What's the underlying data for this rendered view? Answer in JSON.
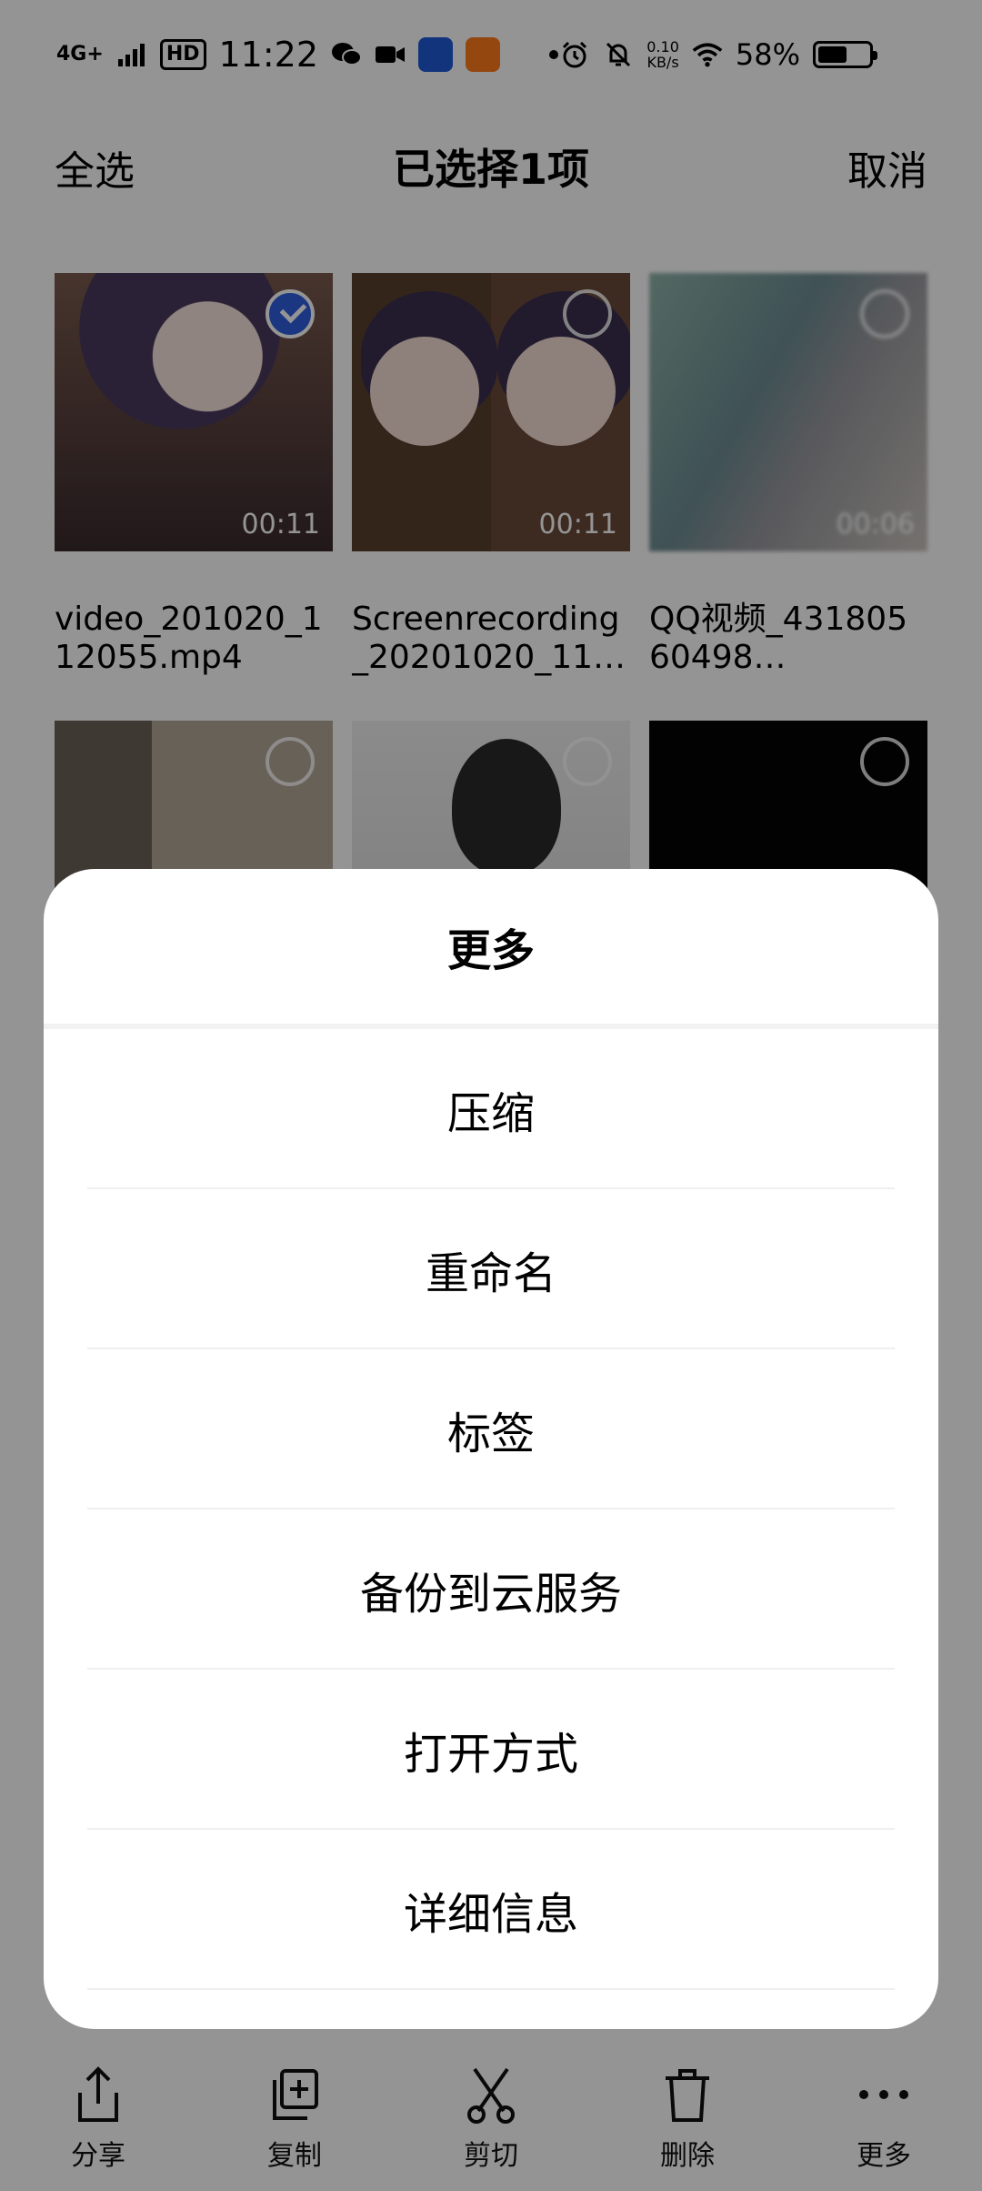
{
  "status_bar": {
    "network": "4G+",
    "hd": "HD",
    "time": "11:22",
    "speed": "0.10\nKB/s",
    "battery": "58%",
    "battery_level": 0.58
  },
  "header": {
    "select_all": "全选",
    "title": "已选择1项",
    "cancel": "取消"
  },
  "files": [
    {
      "name": "video_201020_112055.mp4",
      "duration": "00:11",
      "selected": true
    },
    {
      "name": "Screenrecording_20201020_1111…",
      "duration": "00:11",
      "selected": false
    },
    {
      "name": "QQ视频_43180560498…",
      "duration": "00:06",
      "selected": false
    },
    {
      "name": "",
      "duration": "",
      "selected": false
    },
    {
      "name": "",
      "duration": "",
      "selected": false
    },
    {
      "name": "",
      "duration": "",
      "selected": false
    }
  ],
  "sheet": {
    "title": "更多",
    "items": [
      "压缩",
      "重命名",
      "标签",
      "备份到云服务",
      "打开方式",
      "详细信息"
    ]
  },
  "toolbar": {
    "share": "分享",
    "copy": "复制",
    "cut": "剪切",
    "delete": "删除",
    "more": "更多"
  },
  "colors": {
    "accent": "#2f5fe0",
    "dim": "rgba(0,0,0,0.42)"
  }
}
